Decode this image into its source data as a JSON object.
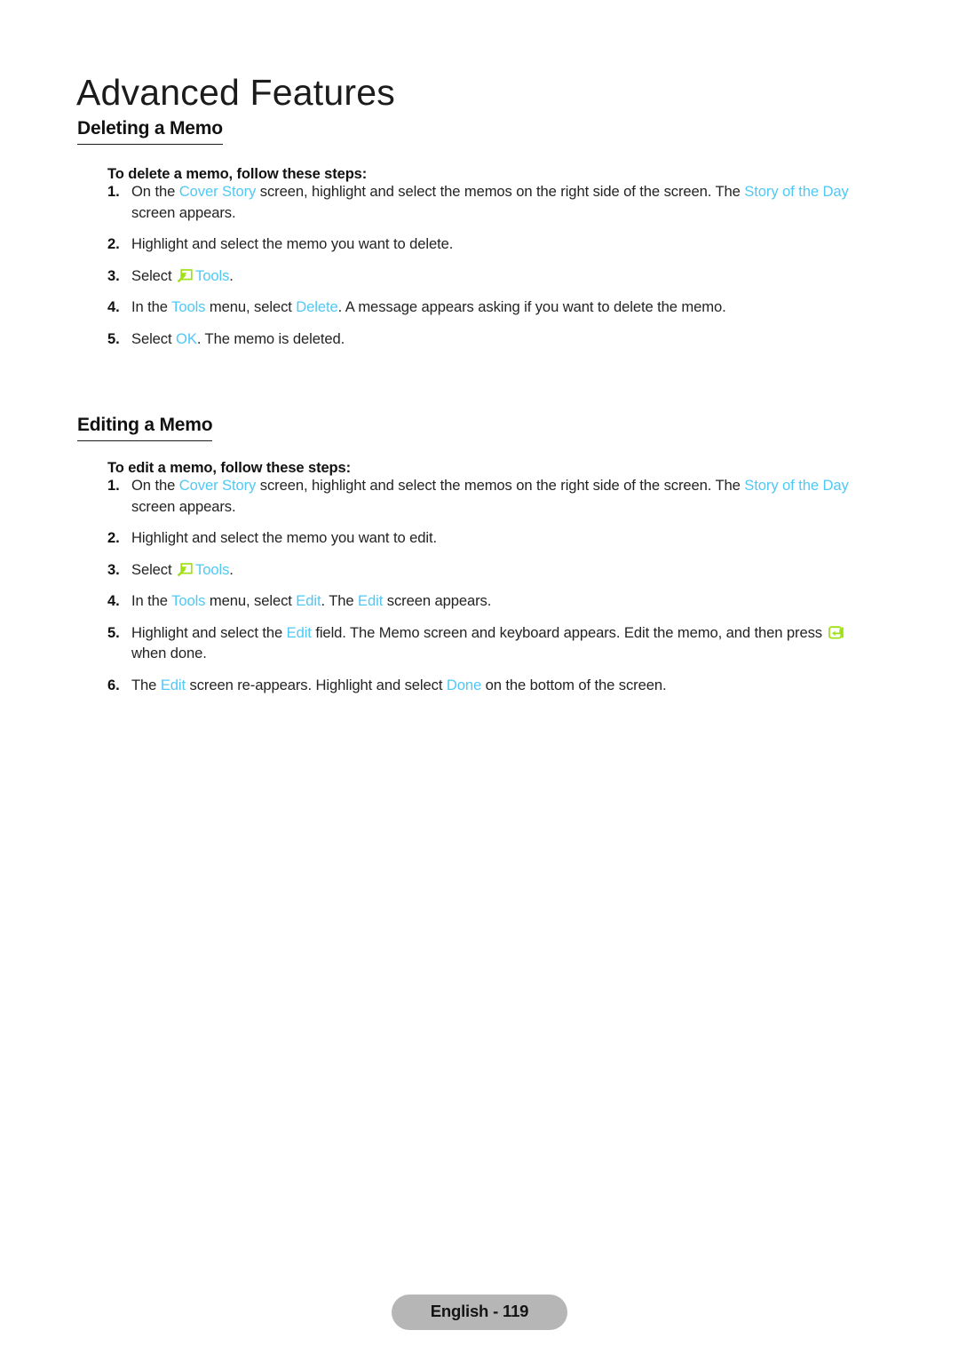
{
  "header": {
    "chapter_title": "Advanced Features"
  },
  "colors": {
    "link_cyan": "#4fc8f5",
    "icon_green": "#9fe016",
    "body_text": "#232323",
    "footer_pill_bg": "#b6b6b6"
  },
  "sections": [
    {
      "id": "deleting-a-memo",
      "heading": "Deleting a Memo",
      "intro": "To delete a memo, follow these steps:",
      "steps": [
        {
          "number": "1.",
          "parts": [
            {
              "type": "text",
              "value": "On the "
            },
            {
              "type": "link",
              "value": "Cover Story"
            },
            {
              "type": "text",
              "value": " screen, highlight and select the memos on the right side of the screen. The "
            },
            {
              "type": "link",
              "value": "Story of the Day"
            },
            {
              "type": "text",
              "value": " screen appears."
            }
          ]
        },
        {
          "number": "2.",
          "parts": [
            {
              "type": "text",
              "value": "Highlight and select the memo you want to delete."
            }
          ]
        },
        {
          "number": "3.",
          "parts": [
            {
              "type": "text",
              "value": "Select "
            },
            {
              "type": "icon",
              "value": "tools-icon"
            },
            {
              "type": "link",
              "value": "Tools"
            },
            {
              "type": "text",
              "value": "."
            }
          ]
        },
        {
          "number": "4.",
          "parts": [
            {
              "type": "text",
              "value": "In the "
            },
            {
              "type": "link",
              "value": "Tools"
            },
            {
              "type": "text",
              "value": " menu, select "
            },
            {
              "type": "link",
              "value": "Delete"
            },
            {
              "type": "text",
              "value": ". A message appears asking if you want to delete the memo."
            }
          ]
        },
        {
          "number": "5.",
          "parts": [
            {
              "type": "text",
              "value": "Select "
            },
            {
              "type": "link",
              "value": "OK"
            },
            {
              "type": "text",
              "value": ". The memo is deleted."
            }
          ]
        }
      ]
    },
    {
      "id": "editing-a-memo",
      "heading": "Editing a Memo",
      "intro": "To edit a memo, follow these steps:",
      "steps": [
        {
          "number": "1.",
          "parts": [
            {
              "type": "text",
              "value": "On the "
            },
            {
              "type": "link",
              "value": "Cover Story"
            },
            {
              "type": "text",
              "value": " screen, highlight and select the memos on the right side of the screen. The "
            },
            {
              "type": "link",
              "value": "Story of the Day"
            },
            {
              "type": "text",
              "value": " screen appears."
            }
          ]
        },
        {
          "number": "2.",
          "parts": [
            {
              "type": "text",
              "value": "Highlight and select the memo you want to edit."
            }
          ]
        },
        {
          "number": "3.",
          "parts": [
            {
              "type": "text",
              "value": "Select "
            },
            {
              "type": "icon",
              "value": "tools-icon"
            },
            {
              "type": "link",
              "value": "Tools"
            },
            {
              "type": "text",
              "value": "."
            }
          ]
        },
        {
          "number": "4.",
          "parts": [
            {
              "type": "text",
              "value": "In the "
            },
            {
              "type": "link",
              "value": "Tools"
            },
            {
              "type": "text",
              "value": " menu, select "
            },
            {
              "type": "link",
              "value": "Edit"
            },
            {
              "type": "text",
              "value": ". The "
            },
            {
              "type": "link",
              "value": "Edit"
            },
            {
              "type": "text",
              "value": " screen appears."
            }
          ]
        },
        {
          "number": "5.",
          "parts": [
            {
              "type": "text",
              "value": "Highlight and select the "
            },
            {
              "type": "link",
              "value": "Edit"
            },
            {
              "type": "text",
              "value": " field. The Memo screen and keyboard appears. Edit the memo, and then press "
            },
            {
              "type": "icon",
              "value": "enter-icon"
            },
            {
              "type": "text",
              "value": " when done."
            }
          ]
        },
        {
          "number": "6.",
          "parts": [
            {
              "type": "text",
              "value": "The "
            },
            {
              "type": "link",
              "value": "Edit"
            },
            {
              "type": "text",
              "value": " screen re-appears. Highlight and select "
            },
            {
              "type": "link",
              "value": "Done"
            },
            {
              "type": "text",
              "value": " on the bottom of the screen."
            }
          ]
        }
      ]
    }
  ],
  "footer": {
    "label": "English - 119"
  }
}
